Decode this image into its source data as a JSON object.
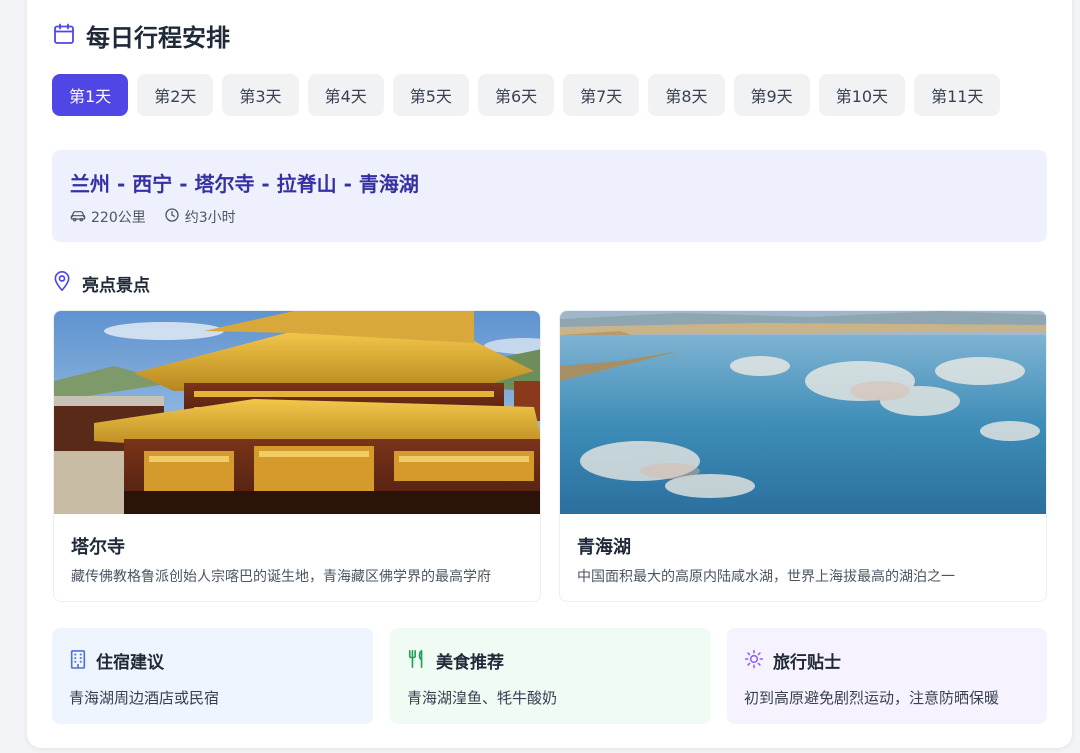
{
  "header": {
    "title": "每日行程安排",
    "icon": "calendar-icon"
  },
  "tabs": [
    {
      "label": "第1天",
      "active": true
    },
    {
      "label": "第2天"
    },
    {
      "label": "第3天"
    },
    {
      "label": "第4天"
    },
    {
      "label": "第5天"
    },
    {
      "label": "第6天"
    },
    {
      "label": "第7天"
    },
    {
      "label": "第8天"
    },
    {
      "label": "第9天"
    },
    {
      "label": "第10天"
    },
    {
      "label": "第11天"
    }
  ],
  "route": {
    "title": "兰州 - 西宁 - 塔尔寺 - 拉脊山 - 青海湖",
    "distance": "220公里",
    "duration": "约3小时"
  },
  "highlights": {
    "label": "亮点景点",
    "spots": [
      {
        "name": "塔尔寺",
        "desc": "藏传佛教格鲁派创始人宗喀巴的诞生地，青海藏区佛学界的最高学府"
      },
      {
        "name": "青海湖",
        "desc": "中国面积最大的高原内陆咸水湖，世界上海拔最高的湖泊之一"
      }
    ]
  },
  "info": {
    "lodging": {
      "title": "住宿建议",
      "text": "青海湖周边酒店或民宿"
    },
    "food": {
      "title": "美食推荐",
      "text": "青海湖湟鱼、牦牛酸奶"
    },
    "tips": {
      "title": "旅行贴士",
      "text": "初到高原避免剧烈运动，注意防晒保暖"
    }
  },
  "colors": {
    "accent": "#4f46e5",
    "route_title": "#3730a3",
    "lodging_icon": "#4f6fd8",
    "food_icon": "#22a05a",
    "tips_icon": "#8b5cf6"
  }
}
